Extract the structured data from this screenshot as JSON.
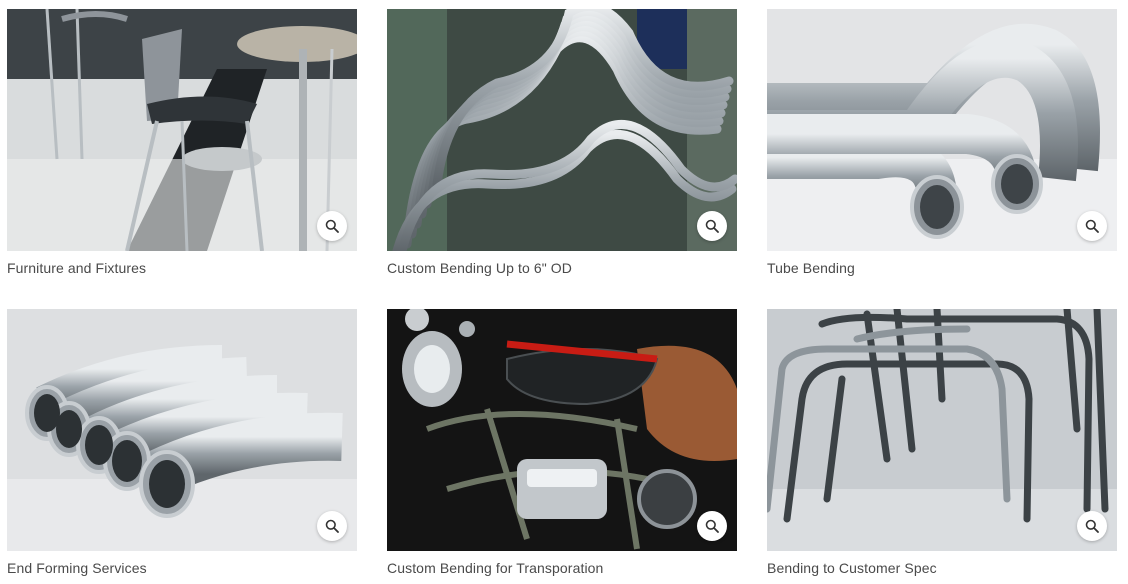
{
  "gallery": {
    "items": [
      {
        "caption": "Furniture and Fixtures",
        "image": "cafe-bar-stools-photo",
        "zoom_icon": "magnifier-icon"
      },
      {
        "caption": "Custom Bending Up to 6\" OD",
        "image": "stacked-bent-tubes-photo",
        "zoom_icon": "magnifier-icon"
      },
      {
        "caption": "Tube Bending",
        "image": "bent-steel-pipes-photo",
        "zoom_icon": "magnifier-icon"
      },
      {
        "caption": "End Forming Services",
        "image": "formed-duct-pipes-photo",
        "zoom_icon": "magnifier-icon"
      },
      {
        "caption": "Custom Bending for Transporation",
        "image": "motorcycle-frame-photo",
        "zoom_icon": "magnifier-icon"
      },
      {
        "caption": "Bending to Customer Spec",
        "image": "bent-rod-frames-photo",
        "zoom_icon": "magnifier-icon"
      }
    ]
  }
}
